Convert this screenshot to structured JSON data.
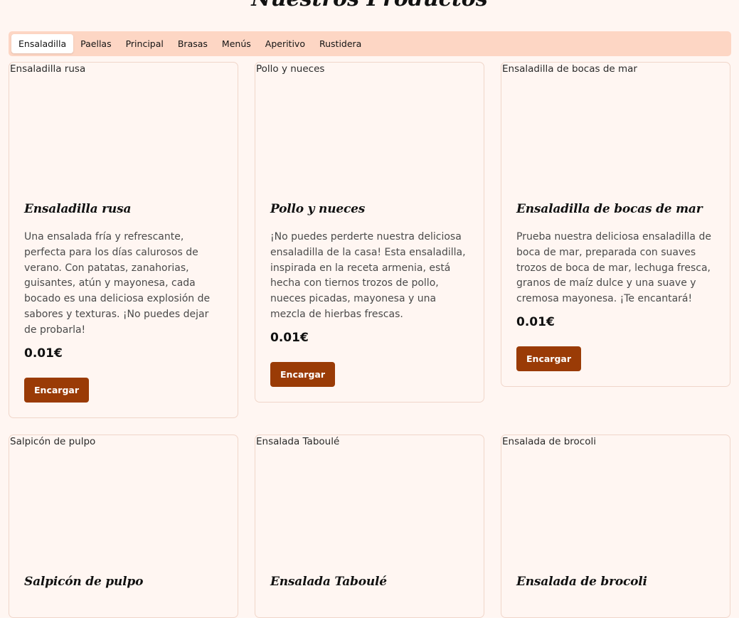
{
  "page": {
    "title": "Nuestros Productos"
  },
  "tabs": [
    {
      "label": "Ensaladilla",
      "active": true
    },
    {
      "label": "Paellas",
      "active": false
    },
    {
      "label": "Principal",
      "active": false
    },
    {
      "label": "Brasas",
      "active": false
    },
    {
      "label": "Menús",
      "active": false
    },
    {
      "label": "Aperitivo",
      "active": false
    },
    {
      "label": "Rustidera",
      "active": false
    }
  ],
  "products": [
    {
      "image_alt": "Ensaladilla rusa",
      "name": "Ensaladilla rusa",
      "description": "Una ensalada fría y refrescante, perfecta para los días calurosos de verano. Con patatas, zanahorias, guisantes, atún y mayonesa, cada bocado es una deliciosa explosión de sabores y texturas. ¡No puedes dejar de probarla!",
      "price": "0.01€",
      "button_label": "Encargar"
    },
    {
      "image_alt": "Pollo y nueces",
      "name": "Pollo y nueces",
      "description": "¡No puedes perderte nuestra deliciosa ensaladilla de la casa! Esta ensaladilla, inspirada en la receta armenia, está hecha con tiernos trozos de pollo, nueces picadas, mayonesa y una mezcla de hierbas frescas.",
      "price": "0.01€",
      "button_label": "Encargar"
    },
    {
      "image_alt": "Ensaladilla de bocas de mar",
      "name": "Ensaladilla de bocas de mar",
      "description": "Prueba nuestra deliciosa ensaladilla de boca de mar, preparada con suaves trozos de boca de mar, lechuga fresca, granos de maíz dulce y una suave y cremosa mayonesa. ¡Te encantará!",
      "price": "0.01€",
      "button_label": "Encargar"
    },
    {
      "image_alt": "Salpicón de pulpo",
      "name": "Salpicón de pulpo"
    },
    {
      "image_alt": "Ensalada Taboulé",
      "name": "Ensalada Taboulé"
    },
    {
      "image_alt": "Ensalada de brocoli",
      "name": "Ensalada de brocoli"
    }
  ],
  "colors": {
    "background": "#fff6f2",
    "tab_bar": "#fdd6c4",
    "button": "#9a3b06",
    "card_border": "#f0d6ca"
  }
}
